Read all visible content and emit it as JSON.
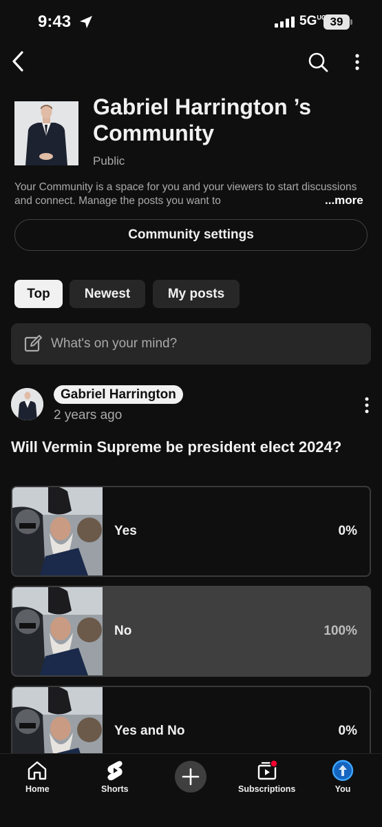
{
  "status_bar": {
    "time": "9:43",
    "network": "5G",
    "network_sup": "UC",
    "battery": "39"
  },
  "header": {
    "community_title": "Gabriel Harrington ’s Community",
    "visibility": "Public",
    "description": "Your Community is a space for you and your viewers to start discussions and connect. Manage the posts you want to",
    "more_label": "...more",
    "settings_label": "Community settings"
  },
  "filters": {
    "chips": [
      {
        "label": "Top",
        "active": true
      },
      {
        "label": "Newest",
        "active": false
      },
      {
        "label": "My posts",
        "active": false
      }
    ]
  },
  "compose": {
    "placeholder": "What's on your mind?"
  },
  "post": {
    "author": "Gabriel Harrington",
    "time": "2 years ago",
    "question": "Will Vermin Supreme be president elect 2024?",
    "options": [
      {
        "label": "Yes",
        "percent": "0%",
        "selected": false
      },
      {
        "label": "No",
        "percent": "100%",
        "selected": true
      },
      {
        "label": "Yes and No",
        "percent": "0%",
        "selected": false
      }
    ]
  },
  "bottom_nav": {
    "items": [
      {
        "label": "Home",
        "icon": "home-icon"
      },
      {
        "label": "Shorts",
        "icon": "shorts-icon"
      },
      {
        "label": "",
        "icon": "create-icon"
      },
      {
        "label": "Subscriptions",
        "icon": "subscriptions-icon"
      },
      {
        "label": "You",
        "icon": "you-icon"
      }
    ]
  },
  "colors": {
    "background": "#0f0f0f",
    "surface": "#272727",
    "text_primary": "#f1f1f1",
    "text_secondary": "#aaaaaa",
    "notification_dot": "#ff0033",
    "you_avatar": "#3ea6ff"
  }
}
